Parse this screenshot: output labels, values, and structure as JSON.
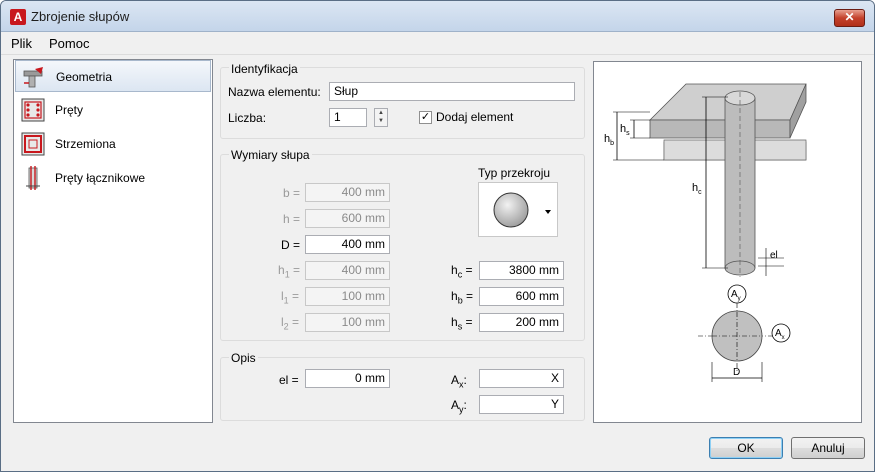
{
  "window": {
    "title": "Zbrojenie słupów",
    "close_label": "✕"
  },
  "menu": {
    "items": [
      "Plik",
      "Pomoc"
    ]
  },
  "sidebar": {
    "items": [
      {
        "label": "Geometria",
        "icon": "geometry-icon",
        "selected": true
      },
      {
        "label": "Pręty",
        "icon": "bars-icon",
        "selected": false
      },
      {
        "label": "Strzemiona",
        "icon": "stirrups-icon",
        "selected": false
      },
      {
        "label": "Pręty łącznikowe",
        "icon": "connector-bars-icon",
        "selected": false
      }
    ]
  },
  "identification": {
    "title": "Identyfikacja",
    "name_label": "Nazwa elementu:",
    "name_value": "Słup",
    "count_label": "Liczba:",
    "count_value": "1",
    "add_label": "Dodaj element",
    "add_checked": true
  },
  "dimensions": {
    "title": "Wymiary słupa",
    "section_type_label": "Typ przekroju",
    "b": {
      "label": "b =",
      "value": "400 mm"
    },
    "h": {
      "label": "h =",
      "value": "600 mm"
    },
    "D": {
      "label": "D =",
      "value": "400 mm"
    },
    "h1": {
      "label_main": "h",
      "label_sub": "1",
      "label_eq": " =",
      "value": "400 mm"
    },
    "l1": {
      "label_main": "l",
      "label_sub": "1",
      "label_eq": " =",
      "value": "100 mm"
    },
    "l2": {
      "label_main": "l",
      "label_sub": "2",
      "label_eq": " =",
      "value": "100 mm"
    },
    "hc": {
      "label_main": "h",
      "label_sub": "c",
      "label_eq": " =",
      "value": "3800 mm"
    },
    "hb": {
      "label_main": "h",
      "label_sub": "b",
      "label_eq": " =",
      "value": "600 mm"
    },
    "hs": {
      "label_main": "h",
      "label_sub": "s",
      "label_eq": " =",
      "value": "200 mm"
    }
  },
  "description": {
    "title": "Opis",
    "el": {
      "label": "el =",
      "value": "0 mm"
    },
    "ax": {
      "label_main": "A",
      "label_sub": "x",
      "label_eq": ":",
      "value": "X"
    },
    "ay": {
      "label_main": "A",
      "label_sub": "y",
      "label_eq": ":",
      "value": "Y"
    }
  },
  "preview": {
    "hs_label": "s",
    "hb_label": "b",
    "hc_label": "c",
    "h": "h",
    "el_label": "el",
    "ay_label": "A",
    "ay_sub": "y",
    "ax_label": "A",
    "ax_sub": "x",
    "d_label": "D"
  },
  "buttons": {
    "ok": "OK",
    "cancel": "Anuluj"
  }
}
